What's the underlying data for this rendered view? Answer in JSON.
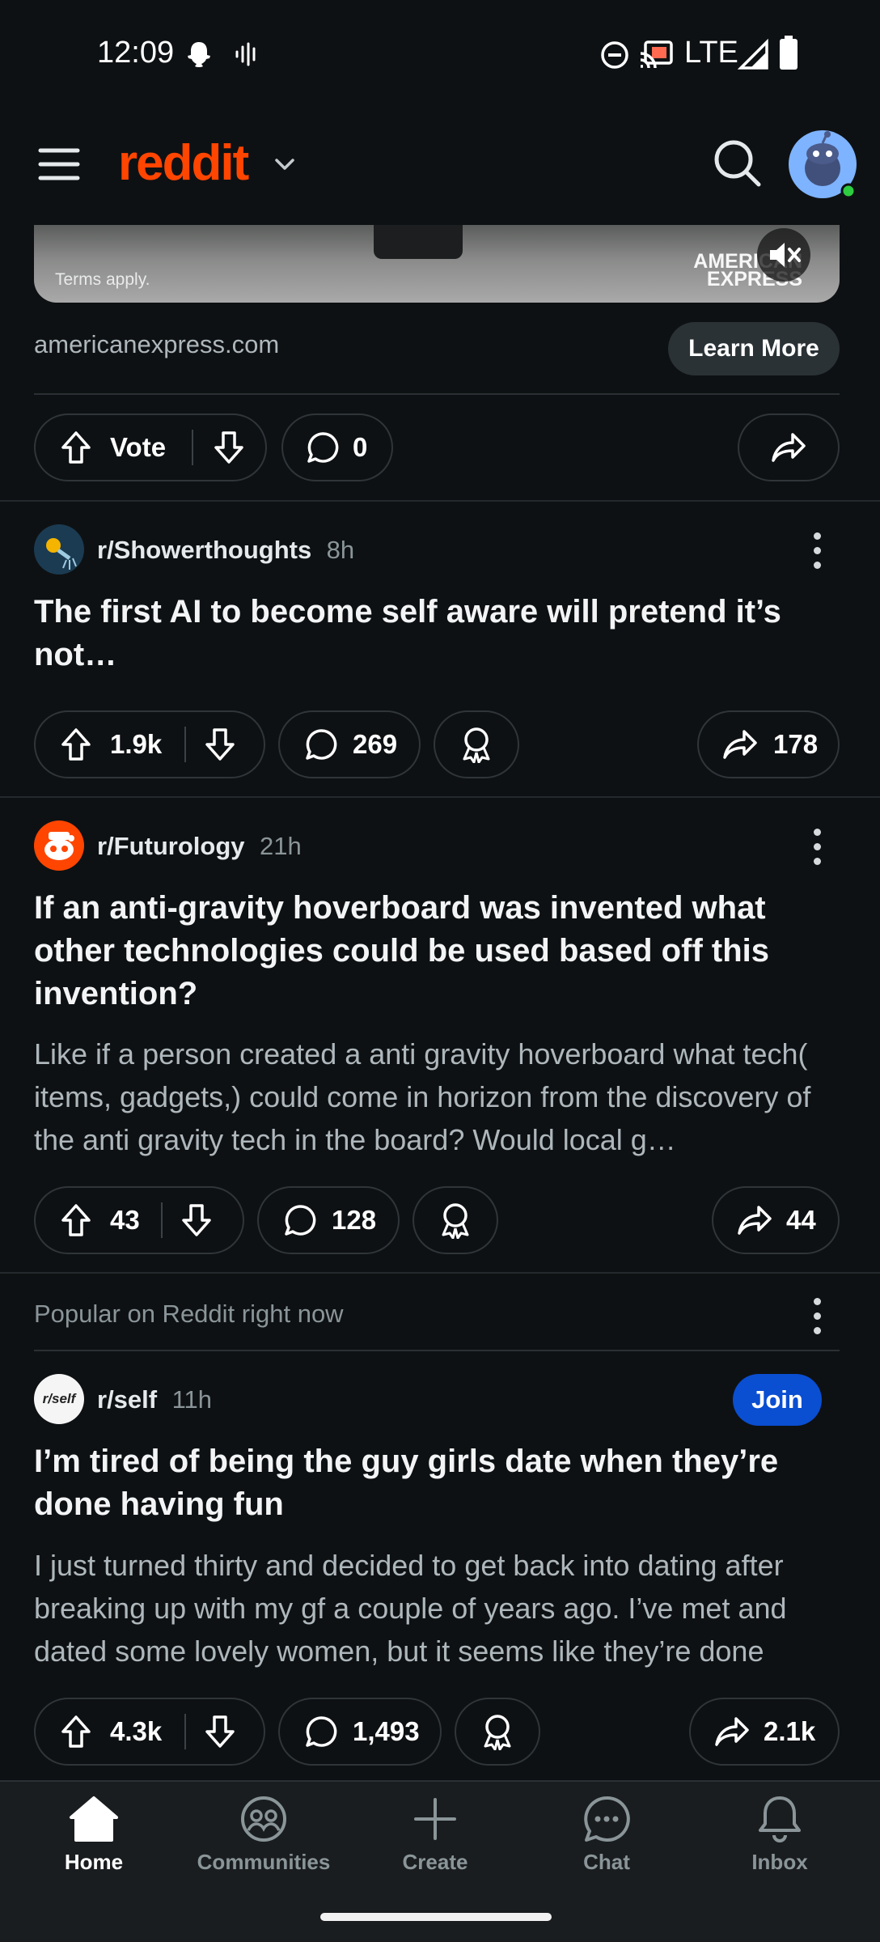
{
  "status_bar": {
    "time": "12:09",
    "network": "LTE"
  },
  "header": {
    "logo": "reddit"
  },
  "ad": {
    "terms": "Terms apply.",
    "brand_line1": "AMERICAN",
    "brand_line2": "EXPRESS",
    "domain": "americanexpress.com",
    "cta": "Learn More",
    "vote_label": "Vote",
    "comments": "0"
  },
  "posts": [
    {
      "subreddit": "r/Showerthoughts",
      "age": "8h",
      "title": "The first AI to become self aware will pretend it’s not…",
      "votes": "1.9k",
      "comments": "269",
      "shares": "178"
    },
    {
      "subreddit": "r/Futurology",
      "age": "21h",
      "title": "If an anti-gravity hoverboard was invented what other technologies could be used based off this invention?",
      "body": "Like if a person created a anti gravity hoverboard what tech( items, gadgets,) could come in horizon from the discovery of the anti gravity tech in the board? Would local g…",
      "votes": "43",
      "comments": "128",
      "shares": "44"
    },
    {
      "section_label": "Popular on Reddit right now",
      "subreddit": "r/self",
      "avatar_text": "r/self",
      "age": "11h",
      "join": "Join",
      "title": "I’m tired of being the guy girls date when they’re done having fun",
      "body": "I just turned thirty and decided to get back into dating after breaking up with my gf a couple of years ago. I’ve met and dated some lovely women, but it seems like they’re done hav…",
      "votes": "4.3k",
      "comments": "1,493",
      "shares": "2.1k"
    }
  ],
  "nav": {
    "home": "Home",
    "communities": "Communities",
    "create": "Create",
    "chat": "Chat",
    "inbox": "Inbox"
  },
  "colors": {
    "brand": "#ff4500",
    "background": "#0e1113",
    "join": "#0a4ed1"
  }
}
